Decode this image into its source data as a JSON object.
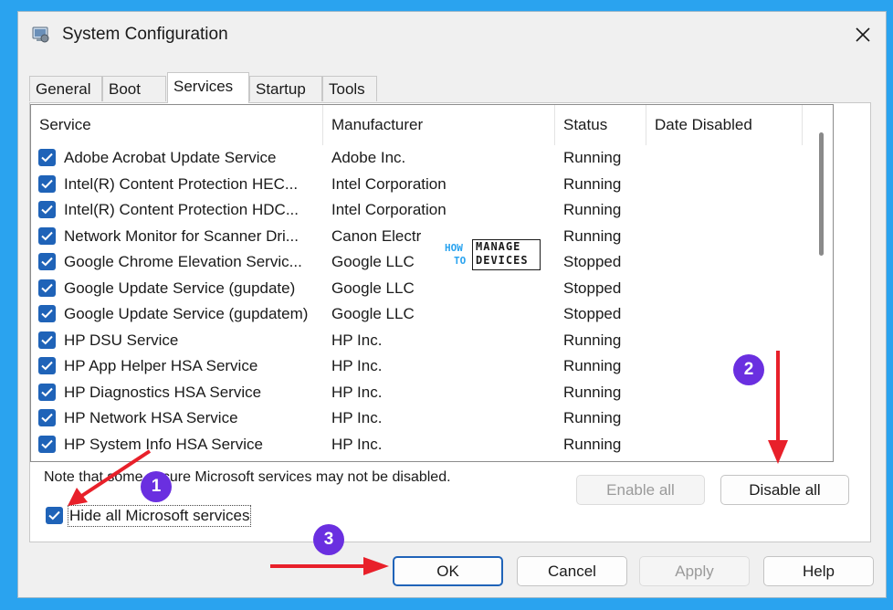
{
  "window": {
    "title": "System Configuration",
    "close_glyph": "✕"
  },
  "tabs": [
    {
      "label": "General"
    },
    {
      "label": "Boot"
    },
    {
      "label": "Services"
    },
    {
      "label": "Startup"
    },
    {
      "label": "Tools"
    }
  ],
  "active_tab": "Services",
  "services_table": {
    "columns": [
      "Service",
      "Manufacturer",
      "Status",
      "Date Disabled"
    ],
    "rows": [
      {
        "service": "Adobe Acrobat Update Service",
        "manufacturer": "Adobe Inc.",
        "status": "Running",
        "date_disabled": "",
        "checked": true
      },
      {
        "service": "Intel(R) Content Protection HEC...",
        "manufacturer": "Intel Corporation",
        "status": "Running",
        "date_disabled": "",
        "checked": true
      },
      {
        "service": "Intel(R) Content Protection HDC...",
        "manufacturer": "Intel Corporation",
        "status": "Running",
        "date_disabled": "",
        "checked": true
      },
      {
        "service": "Network Monitor for Scanner Dri...",
        "manufacturer": "Canon Electr",
        "status": "Running",
        "date_disabled": "",
        "checked": true
      },
      {
        "service": "Google Chrome Elevation Servic...",
        "manufacturer": "Google LLC",
        "status": "Stopped",
        "date_disabled": "",
        "checked": true
      },
      {
        "service": "Google Update Service (gupdate)",
        "manufacturer": "Google LLC",
        "status": "Stopped",
        "date_disabled": "",
        "checked": true
      },
      {
        "service": "Google Update Service (gupdatem)",
        "manufacturer": "Google LLC",
        "status": "Stopped",
        "date_disabled": "",
        "checked": true
      },
      {
        "service": "HP DSU Service",
        "manufacturer": "HP Inc.",
        "status": "Running",
        "date_disabled": "",
        "checked": true
      },
      {
        "service": "HP App Helper HSA Service",
        "manufacturer": "HP Inc.",
        "status": "Running",
        "date_disabled": "",
        "checked": true
      },
      {
        "service": "HP Diagnostics HSA Service",
        "manufacturer": "HP Inc.",
        "status": "Running",
        "date_disabled": "",
        "checked": true
      },
      {
        "service": "HP Network HSA Service",
        "manufacturer": "HP Inc.",
        "status": "Running",
        "date_disabled": "",
        "checked": true
      },
      {
        "service": "HP System Info HSA Service",
        "manufacturer": "HP Inc.",
        "status": "Running",
        "date_disabled": "",
        "checked": true
      }
    ]
  },
  "note": "Note that some secure Microsoft services may not be disabled.",
  "buttons": {
    "enable_all": "Enable all",
    "disable_all": "Disable all",
    "ok": "OK",
    "cancel": "Cancel",
    "apply": "Apply",
    "help": "Help"
  },
  "hide_ms": {
    "label": "Hide all Microsoft services",
    "checked": true
  },
  "annotations": {
    "badge_1": "1",
    "badge_2": "2",
    "badge_3": "3",
    "badge_color": "#6a2fe0",
    "arrow_color": "#e8202a"
  },
  "watermark": {
    "how": "HOW",
    "to": "TO",
    "line1": "MANAGE",
    "line2": "DEVICES"
  },
  "colors": {
    "background": "#2aa3ef",
    "checkbox": "#1f63b8"
  }
}
